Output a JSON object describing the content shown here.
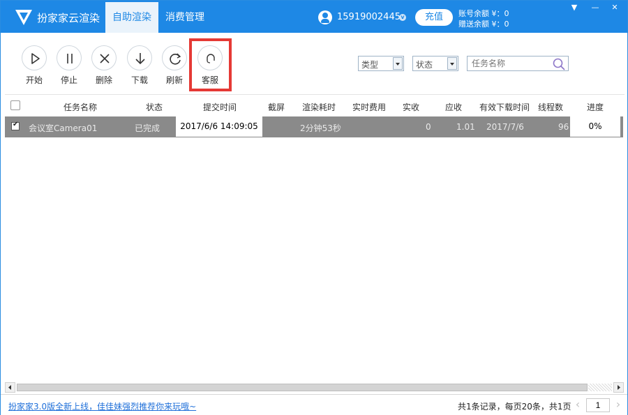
{
  "app": {
    "title": "扮家家云渲染"
  },
  "tabs": [
    {
      "label": "自助渲染",
      "active": true
    },
    {
      "label": "消费管理",
      "active": false
    }
  ],
  "account": {
    "phone": "15919002445",
    "recharge_label": "充值",
    "balance_label": "账号余额 ¥：0",
    "gift_label": "赠送余额 ¥：0"
  },
  "toolbar": {
    "start": "开始",
    "stop": "停止",
    "delete": "删除",
    "download": "下载",
    "refresh": "刷新",
    "service": "客服"
  },
  "filters": {
    "type": "类型",
    "status": "状态",
    "search_placeholder": "任务名称"
  },
  "table": {
    "headers": {
      "name": "任务名称",
      "status": "状态",
      "submit_time": "提交时间",
      "screenshot": "截屏",
      "render_time": "渲染耗时",
      "realtime_cost": "实时费用",
      "actual": "实收",
      "due": "应收",
      "valid_download": "有效下载时间",
      "threads": "线程数",
      "progress": "进度"
    },
    "rows": [
      {
        "name": "会议室Camera01",
        "status": "已完成",
        "submit_time": "2017/6/6 14:09:05",
        "render_time": "2分钟53秒",
        "actual": "0",
        "due": "1.01",
        "valid_download": "2017/7/6",
        "threads": "96",
        "progress": "0%"
      }
    ]
  },
  "footer": {
    "news": "扮家家3.0版全新上线，佳佳妹强烈推荐你来玩哦~",
    "page_info": "共1条记录，每页20条，共1页",
    "page_number": "1"
  },
  "colors": {
    "accent": "#1e88e5",
    "highlight": "#e53935",
    "row_selected": "#8a8a8a"
  }
}
